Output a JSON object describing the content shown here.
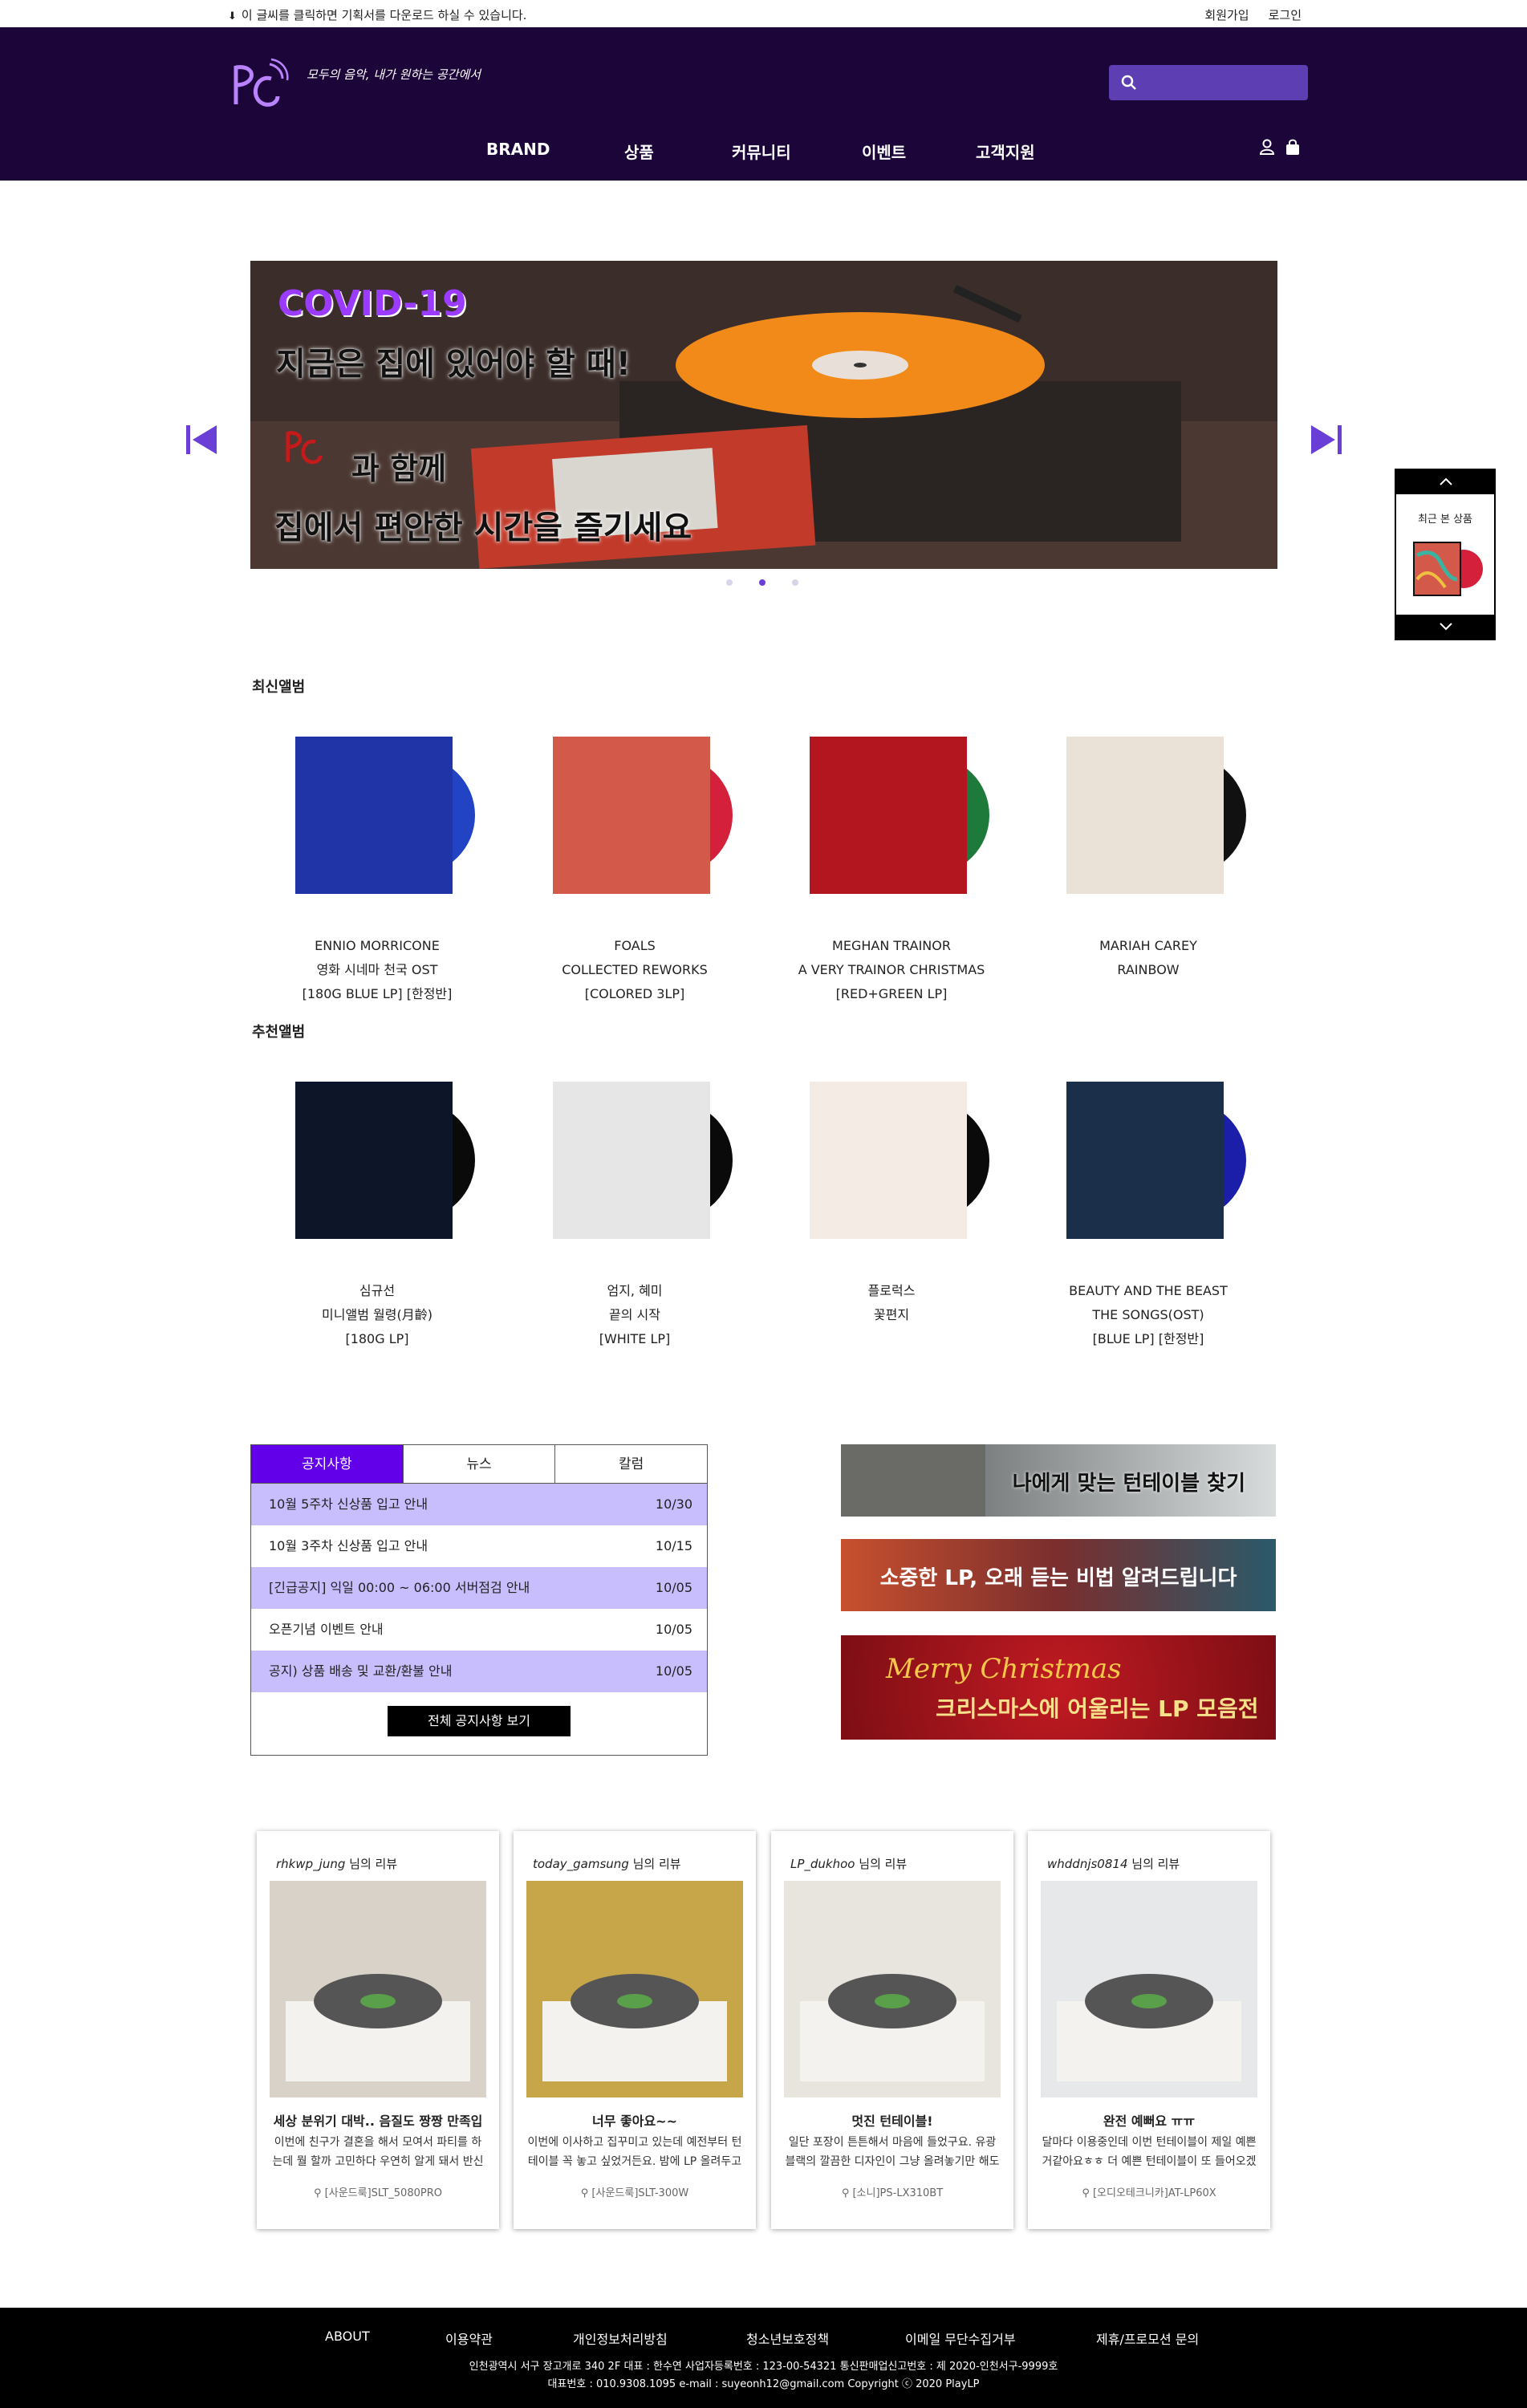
{
  "topbar": {
    "download_text": "이 글씨를 클릭하면 기획서를 다운로드 하실 수 있습니다.",
    "signup": "회원가입",
    "login": "로그인"
  },
  "header": {
    "slogan": "모두의 음악, 내가 원하는 공간에서",
    "nav": [
      "BRAND",
      "상품",
      "커뮤니티",
      "이벤트",
      "고객지원"
    ],
    "search_placeholder": ""
  },
  "hero": {
    "line1": "COVID-19",
    "line2": "지금은 집에 있어야 할 때!",
    "line3": "과 함께",
    "line4": "집에서 편안한 시간을 즐기세요"
  },
  "recent_viewed": {
    "label": "최근 본 상품"
  },
  "new_albums": {
    "title": "최신앨범",
    "items": [
      {
        "l1": "ENNIO MORRICONE",
        "l2": "영화 시네마 천국 OST",
        "l3": "[180G BLUE LP] [한정반]",
        "cover": "#2034a8",
        "disc": "#2244c4"
      },
      {
        "l1": "FOALS",
        "l2": "COLLECTED REWORKS",
        "l3": "[COLORED 3LP]",
        "cover": "#d35a4a",
        "disc": "#d4203a"
      },
      {
        "l1": "MEGHAN TRAINOR",
        "l2": "A VERY TRAINOR CHRISTMAS",
        "l3": "[RED+GREEN LP]",
        "cover": "#b41620",
        "disc": "#1e7a3a"
      },
      {
        "l1": "MARIAH CAREY",
        "l2": "RAINBOW",
        "l3": "",
        "cover": "#eae2d6",
        "disc": "#111111"
      }
    ]
  },
  "recommended": {
    "title": "추천앨범",
    "items": [
      {
        "l1": "심규선",
        "l2": "미니앨범 월령(月齡)",
        "l3": "[180G LP]",
        "cover": "#0d1628",
        "disc": "#0a0a0a"
      },
      {
        "l1": "엄지, 혜미",
        "l2": "끝의 시작",
        "l3": "[WHITE LP]",
        "cover": "#e6e6e6",
        "disc": "#0a0a0a"
      },
      {
        "l1": "플로럭스",
        "l2": "꽃편지",
        "l3": "",
        "cover": "#f4ece4",
        "disc": "#0a0a0a"
      },
      {
        "l1": "BEAUTY AND THE BEAST",
        "l2": "THE SONGS(OST)",
        "l3": "[BLUE LP] [한정반]",
        "cover": "#1c2f4a",
        "disc": "#1a1ea8"
      }
    ]
  },
  "notice": {
    "tabs": [
      "공지사항",
      "뉴스",
      "칼럼"
    ],
    "rows": [
      {
        "title": "10월 5주차 신상품 입고 안내",
        "date": "10/30"
      },
      {
        "title": "10월 3주차 신상품 입고 안내",
        "date": "10/15"
      },
      {
        "title": "[긴급공지] 익일 00:00 ~ 06:00 서버점검 안내",
        "date": "10/05"
      },
      {
        "title": "오픈기념 이벤트 안내",
        "date": "10/05"
      },
      {
        "title": "공지) 상품 배송 및 교환/환불 안내",
        "date": "10/05"
      }
    ],
    "all_button": "전체 공지사항 보기"
  },
  "banners": [
    {
      "text": "나에게 맞는 턴테이블 찾기",
      "bg": "#bfc3c3"
    },
    {
      "text": "소중한 LP, 오래 듣는 비법 알려드립니다",
      "bg": "#c85a3c"
    },
    {
      "script": "Merry Christmas",
      "text": "크리스마스에 어울리는 LP 모음전",
      "bg": "#a8151e"
    }
  ],
  "reviews": [
    {
      "user": "rhkwp_jung",
      "suffix": "님의 리뷰",
      "title": "세상 분위기 대박.. 음질도 짱짱 만족입",
      "text": "이번에 친구가 결혼을 해서 모여서 파티를 하는데 뭘 할까 고민하다 우연히 알게 돼서 반신",
      "product": "[사운드룩]SLT_5080PRO"
    },
    {
      "user": "today_gamsung",
      "suffix": "님의 리뷰",
      "title": "너무 좋아요~~",
      "text": "이번에 이사하고 집꾸미고 있는데 예전부터 턴테이블 꼭 놓고 싶었거든요. 밤에 LP 올려두고",
      "product": "[사운드룩]SLT-300W"
    },
    {
      "user": "LP_dukhoo",
      "suffix": "님의 리뷰",
      "title": "멋진 턴테이블!",
      "text": "일단 포장이 튼튼해서 마음에 들었구요. 유광 블랙의 깔끔한 디자인이 그냥 올려놓기만 해도",
      "product": "[소니]PS-LX310BT"
    },
    {
      "user": "whddnjs0814",
      "suffix": "님의 리뷰",
      "title": "완전 예뻐요 ㅠㅠ",
      "text": "달마다 이용중인데 이번 턴테이블이 제일 예쁜거같아요ㅎㅎ 더 예쁜 턴테이블이 또 들어오겠",
      "product": "[오디오테크니카]AT-LP60X"
    }
  ],
  "footer": {
    "nav": [
      "ABOUT",
      "이용약관",
      "개인정보처리방침",
      "청소년보호정책",
      "이메일 무단수집거부",
      "제휴/프로모션 문의"
    ],
    "info1": "인천광역시 서구 장고개로 340 2F    대표 : 한수연    사업자등록번호 : 123-00-54321    통신판매업신고번호 : 제 2020-인천서구-9999호",
    "info2": "대표번호 : 010.9308.1095    e-mail : suyeonh12@gmail.com    Copyright ⓒ 2020 PlayLP"
  },
  "colors": {
    "header_bg": "#1b0539",
    "accent": "#6200ea",
    "notice_alt": "#c8bdfd"
  }
}
